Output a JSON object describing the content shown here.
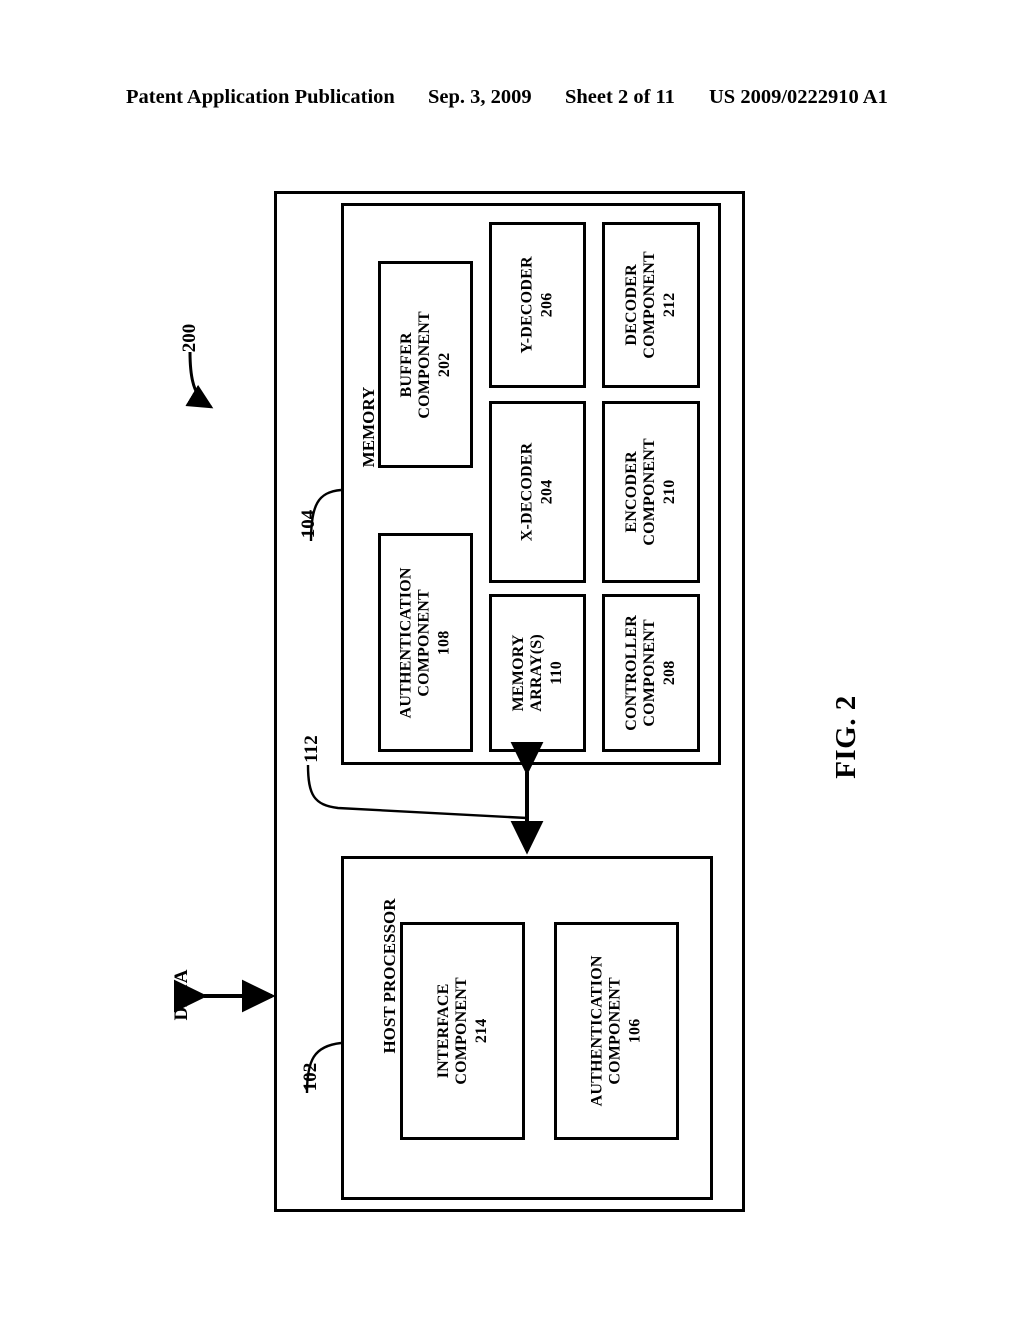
{
  "header": {
    "publication": "Patent Application Publication",
    "date": "Sep. 3, 2009",
    "sheet": "Sheet 2 of 11",
    "patent_number": "US 2009/0222910 A1"
  },
  "figure": {
    "caption": "FIG. 2",
    "system_ref": "200",
    "data_label": "DATA",
    "bus_ref": "112",
    "containers": [
      {
        "id": "memory",
        "title": "MEMORY",
        "ref": "104"
      },
      {
        "id": "host-processor",
        "title": "HOST PROCESSOR",
        "ref": "102"
      }
    ],
    "memory_blocks": [
      {
        "id": "buffer-component",
        "line1": "BUFFER",
        "line2": "COMPONENT",
        "num": "202"
      },
      {
        "id": "authentication-component",
        "line1": "AUTHENTICATION",
        "line2": "COMPONENT",
        "num": "108"
      },
      {
        "id": "y-decoder",
        "line1": "Y-DECODER",
        "line2": "",
        "num": "206"
      },
      {
        "id": "x-decoder",
        "line1": "X-DECODER",
        "line2": "",
        "num": "204"
      },
      {
        "id": "memory-arrays",
        "line1": "MEMORY",
        "line2": "ARRAY(S)",
        "num": "110"
      },
      {
        "id": "decoder-component",
        "line1": "DECODER",
        "line2": "COMPONENT",
        "num": "212"
      },
      {
        "id": "encoder-component",
        "line1": "ENCODER",
        "line2": "COMPONENT",
        "num": "210"
      },
      {
        "id": "controller-component",
        "line1": "CONTROLLER",
        "line2": "COMPONENT",
        "num": "208"
      }
    ],
    "host_blocks": [
      {
        "id": "interface-component",
        "line1": "INTERFACE",
        "line2": "COMPONENT",
        "num": "214"
      },
      {
        "id": "authentication-component-host",
        "line1": "AUTHENTICATION",
        "line2": "COMPONENT",
        "num": "106"
      }
    ]
  }
}
